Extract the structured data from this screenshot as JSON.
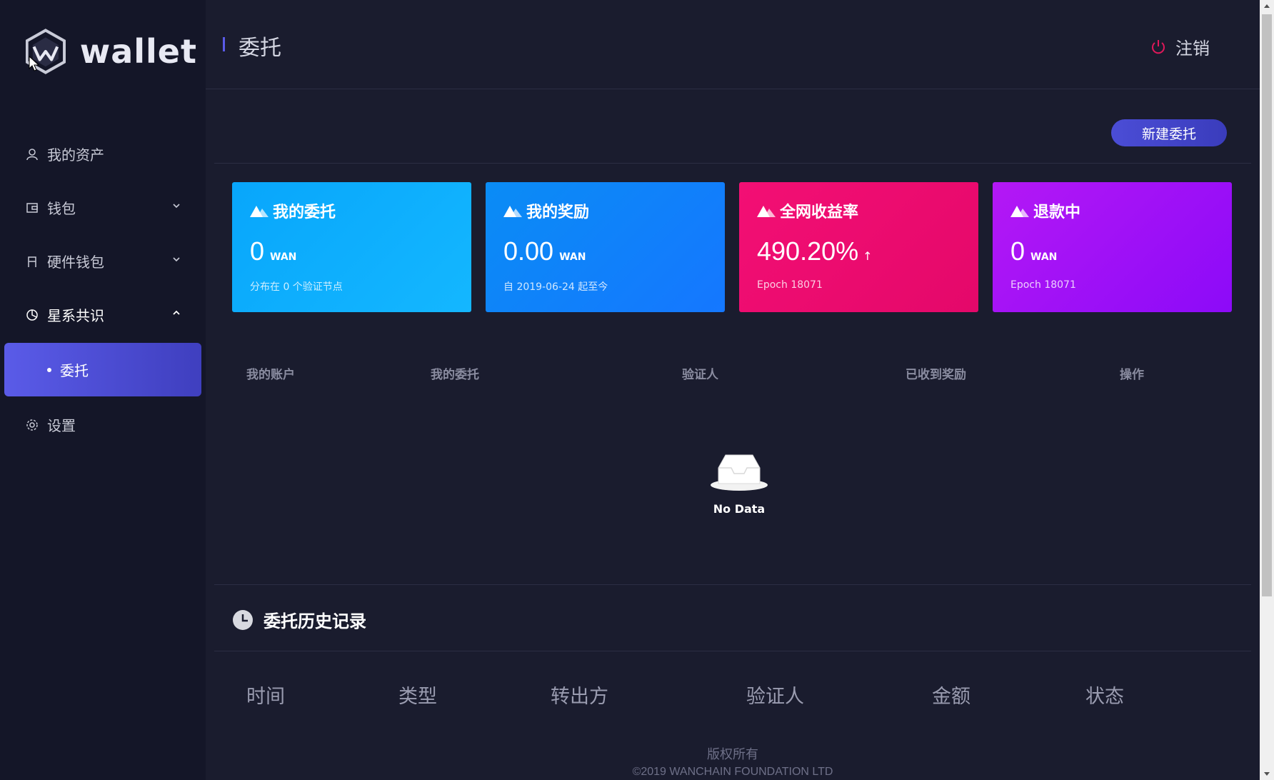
{
  "sidebar": {
    "logo_text": "wallet",
    "items": [
      {
        "label": "我的资产",
        "icon": "user-icon"
      },
      {
        "label": "钱包",
        "icon": "wallet-icon"
      },
      {
        "label": "硬件钱包",
        "icon": "hardware-icon"
      },
      {
        "label": "星系共识",
        "icon": "pie-chart-icon"
      },
      {
        "label": "委托",
        "icon": "dot"
      },
      {
        "label": "设置",
        "icon": "gear-icon"
      }
    ]
  },
  "header": {
    "title": "委托",
    "logout_label": "注销"
  },
  "main": {
    "new_delegation_label": "新建委托",
    "cards": [
      {
        "title": "我的委托",
        "value": "0",
        "unit": "WAN",
        "sub": "分布在 0 个验证节点",
        "color_from": "#08a6fb",
        "color_to": "#14b7ff"
      },
      {
        "title": "我的奖励",
        "value": "0.00",
        "unit": "WAN",
        "sub": "自 2019-06-24 起至今",
        "color_from": "#0a8cf5",
        "color_to": "#1577ff"
      },
      {
        "title": "全网收益率",
        "value": "490.20%",
        "unit": "↑",
        "sub": "Epoch 18071",
        "color_from": "#f30f74",
        "color_to": "#e4086a"
      },
      {
        "title": "退款中",
        "value": "0",
        "unit": "WAN",
        "sub": "Epoch 18071",
        "color_from": "#b418f5",
        "color_to": "#8c0af8"
      }
    ],
    "table_headers": [
      "我的账户",
      "我的委托",
      "验证人",
      "已收到奖励",
      "操作"
    ],
    "no_data": "No Data",
    "history_title": "委托历史记录",
    "history_headers": [
      "时间",
      "类型",
      "转出方",
      "验证人",
      "金额",
      "状态"
    ]
  },
  "footer": {
    "line1": "版权所有",
    "line2": "©2019 WANCHAIN FOUNDATION LTD"
  }
}
